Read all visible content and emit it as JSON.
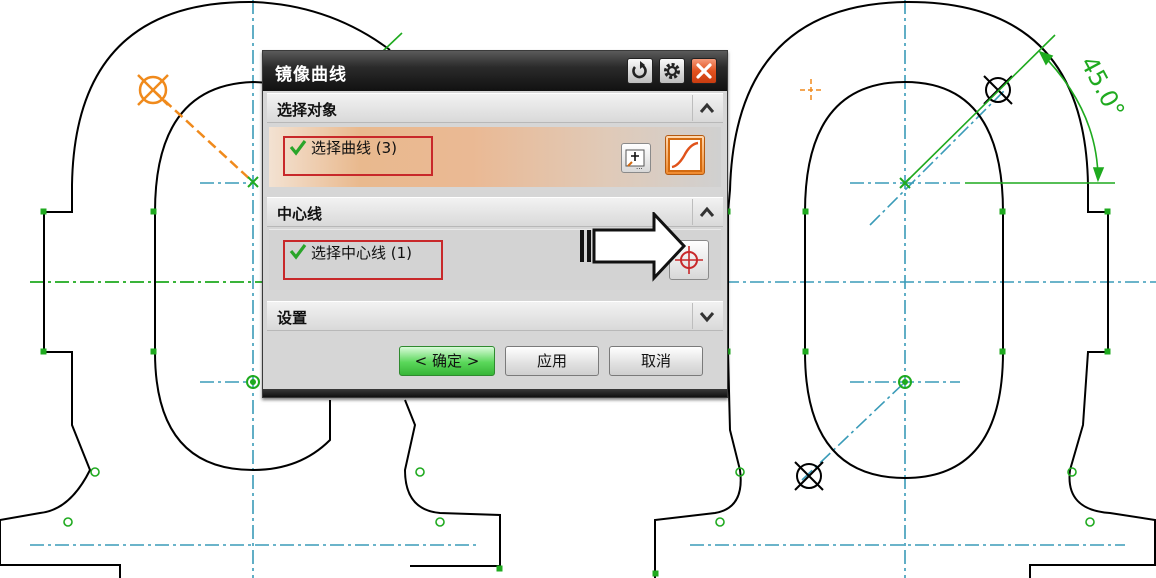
{
  "dialog": {
    "title": "镜像曲线",
    "sections": {
      "select_object": "选择对象",
      "centerline": "中心线",
      "settings": "设置"
    },
    "select_curve_label": "选择曲线 (3)",
    "select_centerline_label": "选择中心线 (1)",
    "buttons": {
      "ok": "< 确定 >",
      "apply": "应用",
      "cancel": "取消"
    }
  },
  "drawing": {
    "dimension_text": "45.0°",
    "line_color": "#000000",
    "centerline_color": "#3a9bb8",
    "constraint_color": "#1faa1f",
    "highlight_color": "#f08a1c"
  },
  "colors": {
    "selection_red": "#c8282a",
    "title_bar": "#1e1e1e",
    "ok_green": "#46c846"
  }
}
